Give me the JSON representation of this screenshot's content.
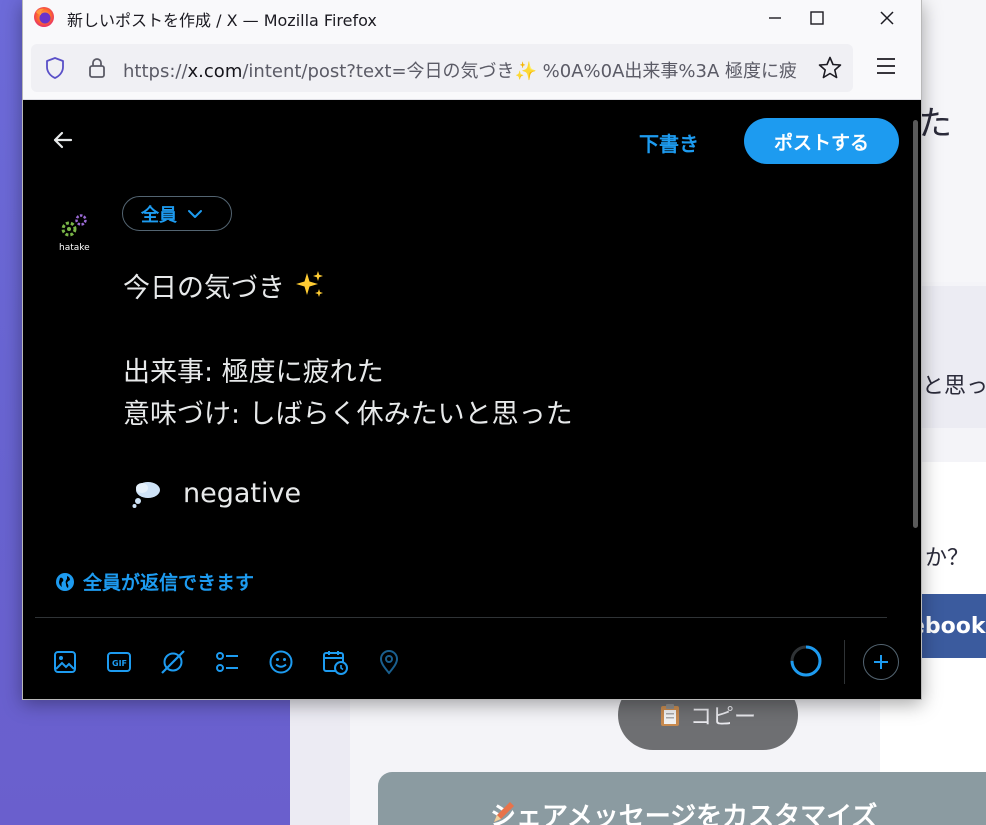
{
  "window": {
    "title": "新しいポストを作成 / X — Mozilla Firefox",
    "url_prefix": "https://",
    "url_host": "x.com",
    "url_path": "/intent/post?text=今日の気づき✨ %0A%0A出来事%3A 極度に疲"
  },
  "compose": {
    "drafts_label": "下書き",
    "post_label": "ポストする",
    "audience_label": "全員",
    "avatar_text": "hatake",
    "body": {
      "line1": "今日の気づき",
      "line2": "出来事: 極度に疲れた",
      "line3": "意味づけ: しばらく休みたいと思った",
      "mood": "negative"
    },
    "reply_setting": "全員が返信できます",
    "toolbar_icons": [
      "image-icon",
      "gif-icon",
      "grok-icon",
      "poll-icon",
      "emoji-icon",
      "schedule-icon",
      "location-icon"
    ],
    "accent_color": "#1d9bf0"
  },
  "background_page": {
    "top_char": "た",
    "think_text": "と思っ",
    "question_text": "か？",
    "facebook_label": "ebook",
    "copy_label": "コピー",
    "customize_label": "シェアメッセージをカスタマイズ"
  }
}
